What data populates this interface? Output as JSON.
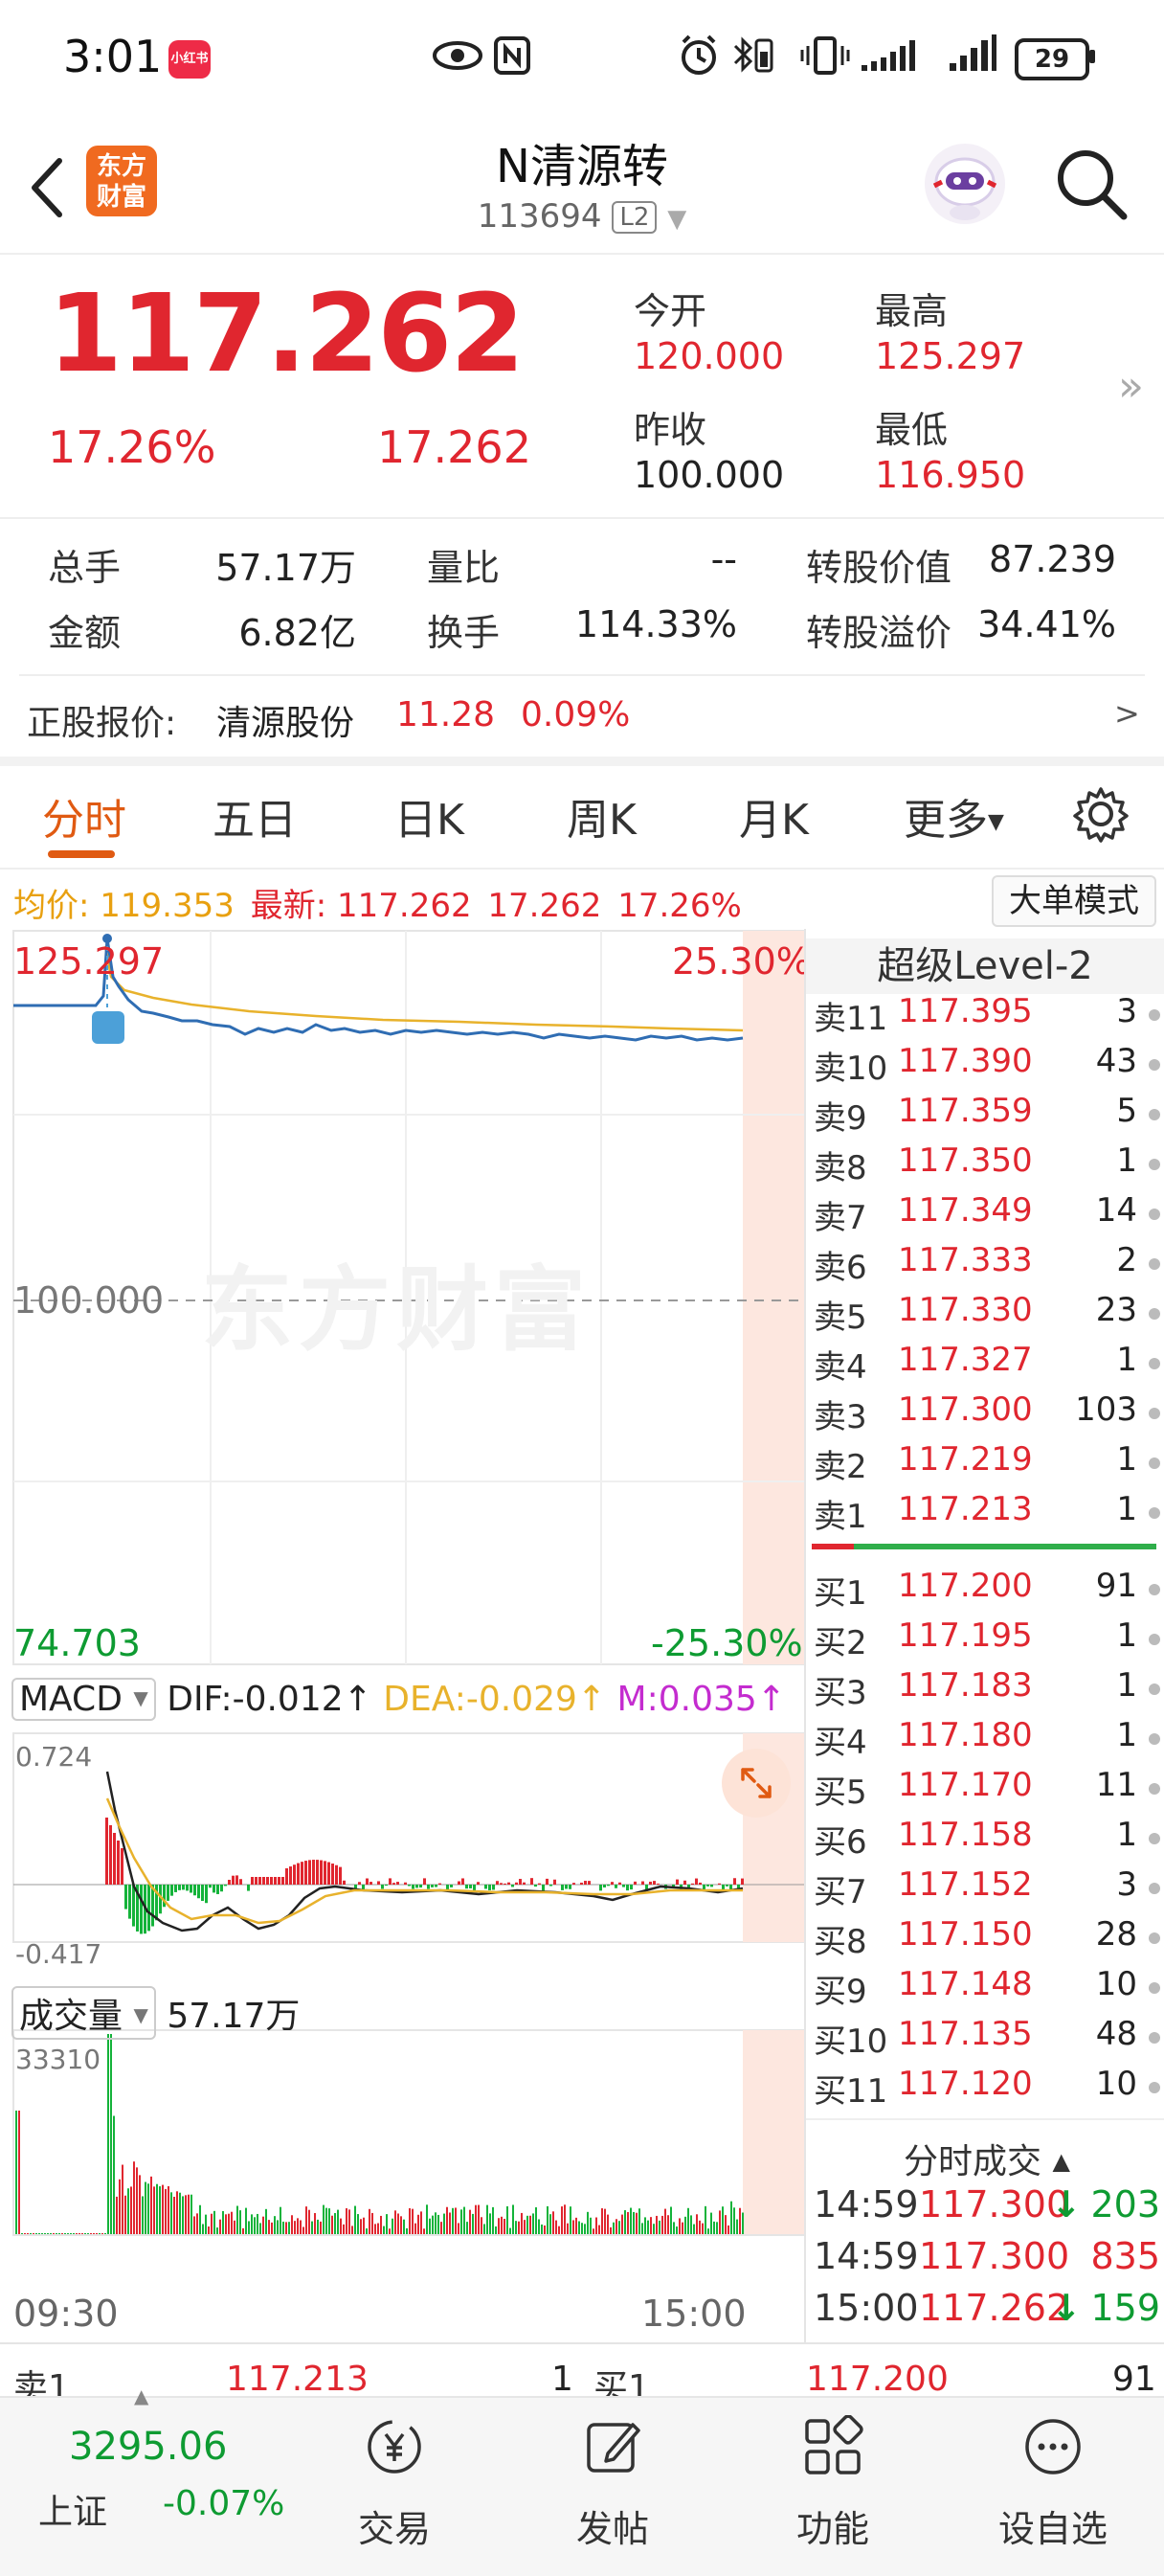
{
  "status_bar": {
    "time": "3:01",
    "app_badge": "小红书",
    "battery": "29"
  },
  "header": {
    "logo_text_line1": "东方",
    "logo_text_line2": "财富",
    "stock_name": "N清源转",
    "stock_code": "113694",
    "level_badge": "L2"
  },
  "quote": {
    "last_price": "117.262",
    "change_pct": "17.26%",
    "change_amt": "17.262",
    "open_label": "今开",
    "open_value": "120.000",
    "high_label": "最高",
    "high_value": "125.297",
    "prev_close_label": "昨收",
    "prev_close_value": "100.000",
    "low_label": "最低",
    "low_value": "116.950"
  },
  "stats": {
    "total_hand_label": "总手",
    "total_hand_value": "57.17万",
    "volume_ratio_label": "量比",
    "volume_ratio_value": "--",
    "conversion_value_label": "转股价值",
    "conversion_value_value": "87.239",
    "amount_label": "金额",
    "amount_value": "6.82亿",
    "turnover_label": "换手",
    "turnover_value": "114.33%",
    "conversion_premium_label": "转股溢价",
    "conversion_premium_value": "34.41%"
  },
  "underlying": {
    "label": "正股报价:",
    "name": "清源股份",
    "price": "11.28",
    "change": "0.09%",
    "arrow": ">"
  },
  "tabs": {
    "intraday": "分时",
    "five_day": "五日",
    "daily": "日K",
    "weekly": "周K",
    "monthly": "月K",
    "more": "更多"
  },
  "chart_info": {
    "avg_label": "均价:",
    "avg_value": "119.353",
    "latest_label": "最新:",
    "latest_price": "117.262",
    "latest_change": "17.262",
    "latest_pct": "17.26%",
    "big_order_mode": "大单模式",
    "price_high": "125.297",
    "pct_high": "25.30%",
    "price_mid": "100.000",
    "price_low": "74.703",
    "pct_low": "-25.30%",
    "sell_marker": "S",
    "watermark": "东方财富",
    "time_start": "09:30",
    "time_end": "15:00"
  },
  "macd": {
    "select_label": "MACD",
    "dif": "DIF:-0.012",
    "dea": "DEA:-0.029",
    "m": "M:0.035",
    "top": "0.724",
    "bottom": "-0.417"
  },
  "volume": {
    "select_label": "成交量",
    "total": "57.17万",
    "max": "33310"
  },
  "order_book": {
    "title": "超级Level-2",
    "asks": [
      {
        "label": "卖11",
        "price": "117.395",
        "vol": "3"
      },
      {
        "label": "卖10",
        "price": "117.390",
        "vol": "43"
      },
      {
        "label": "卖9",
        "price": "117.359",
        "vol": "5"
      },
      {
        "label": "卖8",
        "price": "117.350",
        "vol": "1"
      },
      {
        "label": "卖7",
        "price": "117.349",
        "vol": "14"
      },
      {
        "label": "卖6",
        "price": "117.333",
        "vol": "2"
      },
      {
        "label": "卖5",
        "price": "117.330",
        "vol": "23"
      },
      {
        "label": "卖4",
        "price": "117.327",
        "vol": "1"
      },
      {
        "label": "卖3",
        "price": "117.300",
        "vol": "103"
      },
      {
        "label": "卖2",
        "price": "117.219",
        "vol": "1"
      },
      {
        "label": "卖1",
        "price": "117.213",
        "vol": "1"
      }
    ],
    "bids": [
      {
        "label": "买1",
        "price": "117.200",
        "vol": "91"
      },
      {
        "label": "买2",
        "price": "117.195",
        "vol": "1"
      },
      {
        "label": "买3",
        "price": "117.183",
        "vol": "1"
      },
      {
        "label": "买4",
        "price": "117.180",
        "vol": "1"
      },
      {
        "label": "买5",
        "price": "117.170",
        "vol": "11"
      },
      {
        "label": "买6",
        "price": "117.158",
        "vol": "1"
      },
      {
        "label": "买7",
        "price": "117.152",
        "vol": "3"
      },
      {
        "label": "买8",
        "price": "117.150",
        "vol": "28"
      },
      {
        "label": "买9",
        "price": "117.148",
        "vol": "10"
      },
      {
        "label": "买10",
        "price": "117.135",
        "vol": "48"
      },
      {
        "label": "买11",
        "price": "117.120",
        "vol": "10"
      }
    ]
  },
  "trades": {
    "title": "分时成交",
    "rows": [
      {
        "time": "14:59",
        "price": "117.300",
        "arrow": "↓",
        "vol": "203"
      },
      {
        "time": "14:59",
        "price": "117.300",
        "arrow": "",
        "vol": "835"
      },
      {
        "time": "15:00",
        "price": "117.262",
        "arrow": "↓",
        "vol": "159"
      }
    ]
  },
  "bottom_quote": {
    "ask_label": "卖1",
    "ask_price": "117.213",
    "ask_vol": "1",
    "bid_label": "买1",
    "bid_price": "117.200",
    "bid_vol": "91"
  },
  "bottom_nav": {
    "index_value": "3295.06",
    "index_name": "上证",
    "index_change": "-0.07%",
    "trade": "交易",
    "post": "发帖",
    "functions": "功能",
    "watchlist": "设自选"
  },
  "colors": {
    "up_red": "#e0262f",
    "down_green": "#0e9b32",
    "accent_orange": "#e05a12",
    "price_line_blue": "#2f6db3",
    "avg_line_yellow": "#e8b22c",
    "macd_purple": "#c42ccf"
  }
}
